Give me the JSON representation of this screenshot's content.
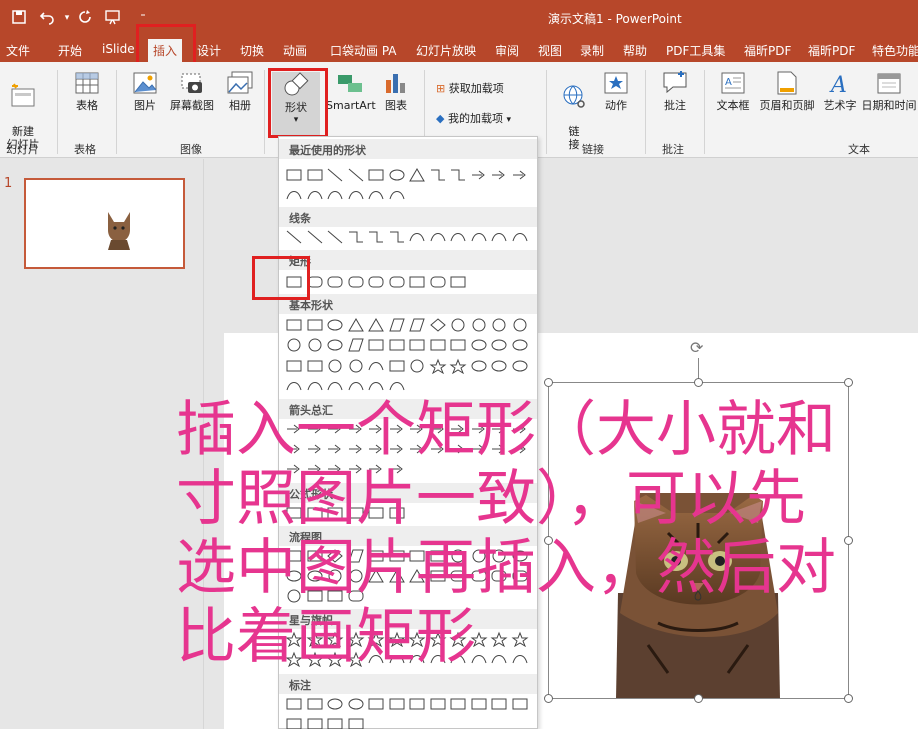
{
  "window": {
    "title": "演示文稿1  -  PowerPoint",
    "brand_color": "#b7472a"
  },
  "tabs": [
    {
      "label": "文件"
    },
    {
      "label": "开始"
    },
    {
      "label": "iSlide"
    },
    {
      "label": "插入"
    },
    {
      "label": "设计"
    },
    {
      "label": "切换"
    },
    {
      "label": "动画"
    },
    {
      "label": "口袋动画 PA"
    },
    {
      "label": "幻灯片放映"
    },
    {
      "label": "审阅"
    },
    {
      "label": "视图"
    },
    {
      "label": "录制"
    },
    {
      "label": "帮助"
    },
    {
      "label": "PDF工具集"
    },
    {
      "label": "福昕PDF"
    },
    {
      "label": "福昕PDF"
    },
    {
      "label": "特色功能"
    }
  ],
  "ribbon": {
    "new_slide": "新建\n幻灯片",
    "table": "表格",
    "picture": "图片",
    "screenshot": "屏幕截图",
    "album": "相册",
    "shapes": "形状",
    "smartart": "SmartArt",
    "chart": "图表",
    "get_addins": "获取加载项",
    "my_addins": "我的加载项",
    "link": "链\n接",
    "action": "动作",
    "comment": "批注",
    "textbox": "文本框",
    "header_footer": "页眉和页脚",
    "wordart": "艺术字",
    "datetime": "日期和时间",
    "groups": {
      "slides": "幻灯片",
      "tables": "表格",
      "images": "图像",
      "links": "链接",
      "comments": "批注",
      "text": "文本"
    }
  },
  "thumbnail": {
    "number": "1"
  },
  "shapes_menu": {
    "sections": [
      "最近使用的形状",
      "线条",
      "矩形",
      "基本形状",
      "箭头总汇",
      "公式形状",
      "流程图",
      "星与旗帜",
      "标注"
    ]
  },
  "annotation": "插入一个矩形（大小就和\n寸照图片一致），可以先\n选中图片再插入，然后对\n比着画矩形",
  "colors": {
    "annotation": "#e6358f",
    "highlight": "#e02020"
  }
}
